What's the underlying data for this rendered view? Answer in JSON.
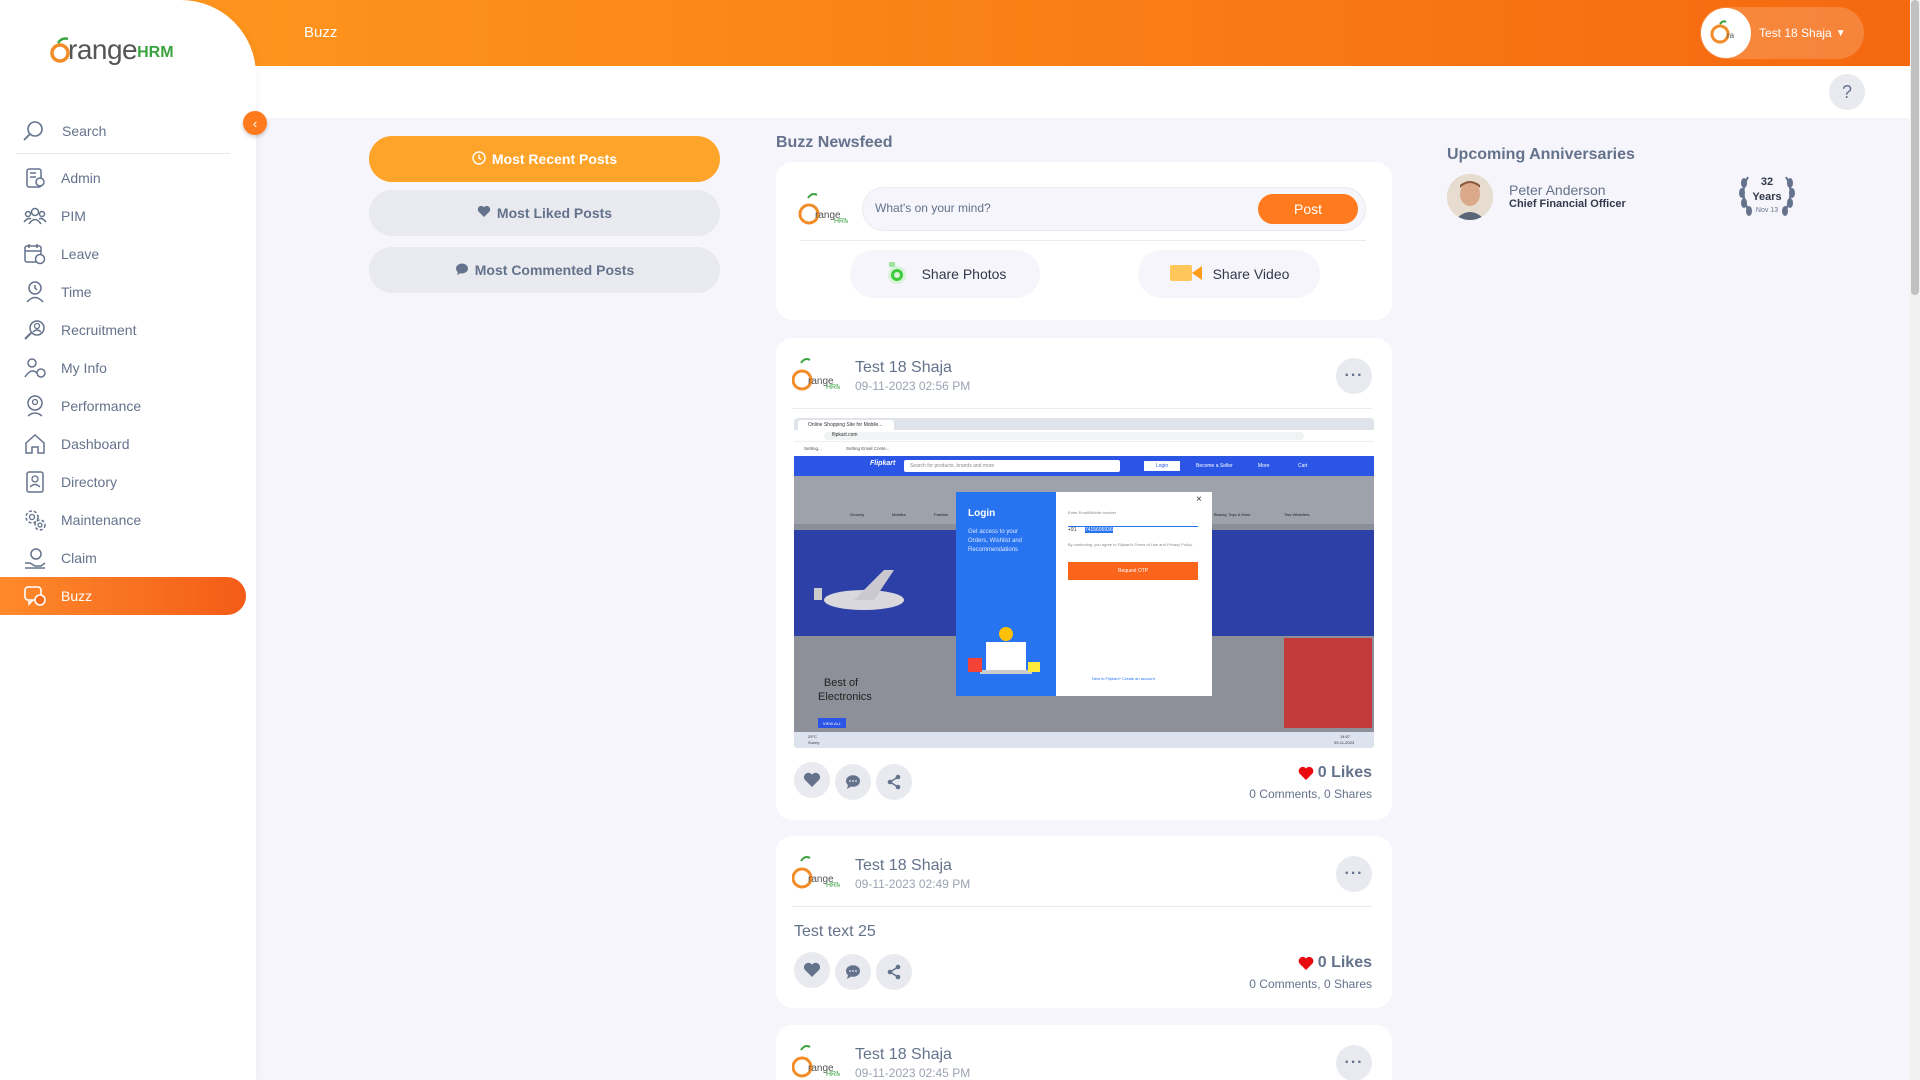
{
  "app": {
    "brand_main": "range",
    "brand_first": "O",
    "brand_suffix": "HRM",
    "page_title": "Buzz",
    "user_name": "Test 18 Shaja",
    "help_label": "?",
    "accent_color": "#ff7b1d"
  },
  "sidebar": {
    "search_placeholder": "Search",
    "items": [
      {
        "label": "Admin",
        "icon": "admin-icon"
      },
      {
        "label": "PIM",
        "icon": "pim-icon"
      },
      {
        "label": "Leave",
        "icon": "leave-icon"
      },
      {
        "label": "Time",
        "icon": "time-icon"
      },
      {
        "label": "Recruitment",
        "icon": "recruitment-icon"
      },
      {
        "label": "My Info",
        "icon": "my-info-icon"
      },
      {
        "label": "Performance",
        "icon": "performance-icon"
      },
      {
        "label": "Dashboard",
        "icon": "dashboard-icon"
      },
      {
        "label": "Directory",
        "icon": "directory-icon"
      },
      {
        "label": "Maintenance",
        "icon": "maintenance-icon"
      },
      {
        "label": "Claim",
        "icon": "claim-icon"
      },
      {
        "label": "Buzz",
        "icon": "buzz-icon",
        "active": true
      }
    ]
  },
  "filters": {
    "most_recent": "Most Recent Posts",
    "most_liked": "Most Liked Posts",
    "most_commented": "Most Commented Posts"
  },
  "newsfeed": {
    "title": "Buzz Newsfeed",
    "composer_placeholder": "What's on your mind?",
    "post_button": "Post",
    "share_photos": "Share Photos",
    "share_video": "Share Video"
  },
  "posts": [
    {
      "author": "Test 18 Shaja",
      "date": "09-11-2023 02:56 PM",
      "has_image": true,
      "likes": "0 Likes",
      "comments": "0 Comments",
      "shares": "0 Shares"
    },
    {
      "author": "Test 18 Shaja",
      "date": "09-11-2023 02:49 PM",
      "text": "Test text 25",
      "likes": "0 Likes",
      "comments": "0 Comments",
      "shares": "0 Shares"
    },
    {
      "author": "Test 18 Shaja",
      "date": "09-11-2023 02:45 PM"
    }
  ],
  "anniversaries": {
    "title": "Upcoming Anniversaries",
    "name": "Peter Anderson",
    "role": "Chief Financial Officer",
    "years_num": "32",
    "years_label": "Years",
    "date": "Nov 13"
  },
  "screenshot": {
    "tab_title": "Online Shopping Site for Mobile...",
    "url": "flipkart.com",
    "bookmark1": "Setting...",
    "bookmark2": "Setting Email Conte...",
    "site_logo": "Flipkart",
    "site_search": "Search for products, brands and more",
    "site_login": "Login",
    "site_seller": "Become a Seller",
    "site_more": "More",
    "site_cart": "Cart",
    "categories": [
      "Grocery",
      "Mobiles",
      "Fashion",
      "Electronics",
      "Home",
      "Appliances",
      "Travel",
      "Beauty, Toys & More",
      "Two Wheelers"
    ],
    "login_title": "Login",
    "login_desc": "Get access to your Orders, Wishlist and Recommendations",
    "login_field_label": "Enter Email/Mobile number",
    "login_prefix": "+91",
    "login_phone": "7415695936",
    "login_terms": "By continuing, you agree to Flipkart's Terms of Use and Privacy Policy.",
    "login_button": "Request OTP",
    "login_create": "New to Flipkart? Create an account",
    "promo_title": "Best of Electronics",
    "promo_btn": "VIEW ALL",
    "taskbar_temp": "29°C",
    "taskbar_weather": "Sunny",
    "taskbar_time": "14:57",
    "taskbar_date": "09-11-2023"
  }
}
